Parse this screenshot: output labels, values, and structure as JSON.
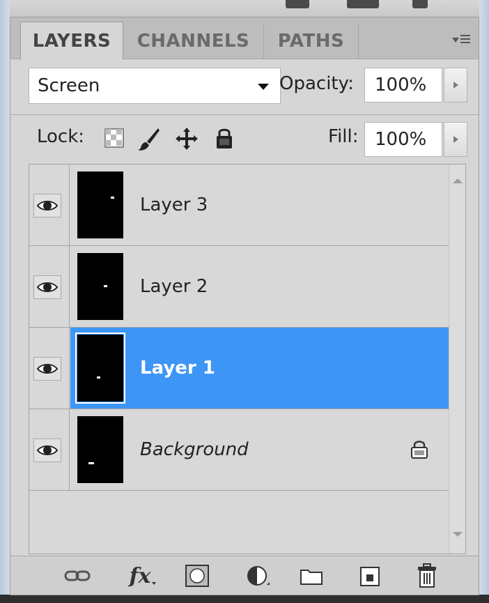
{
  "tabs": [
    {
      "label": "LAYERS",
      "active": true
    },
    {
      "label": "CHANNELS",
      "active": false
    },
    {
      "label": "PATHS",
      "active": false
    }
  ],
  "blend_mode": "Screen",
  "opacity": {
    "label": "Opacity:",
    "value": "100%"
  },
  "lock": {
    "label": "Lock:"
  },
  "fill": {
    "label": "Fill:",
    "value": "100%"
  },
  "layers": [
    {
      "name": "Layer 3",
      "selected": false,
      "visible": true,
      "locked": false
    },
    {
      "name": "Layer 2",
      "selected": false,
      "visible": true,
      "locked": false
    },
    {
      "name": "Layer 1",
      "selected": true,
      "visible": true,
      "locked": false
    },
    {
      "name": "Background",
      "selected": false,
      "visible": true,
      "locked": true
    }
  ],
  "toolbar_icons": [
    "link-layers-icon",
    "fx-icon",
    "add-mask-icon",
    "adjustment-layer-icon",
    "new-group-icon",
    "new-layer-icon",
    "delete-layer-icon"
  ],
  "toolbar_text": {
    "fx": "fx"
  },
  "colors": {
    "selected": "#3d96f5",
    "panel": "#d6d6d6"
  }
}
